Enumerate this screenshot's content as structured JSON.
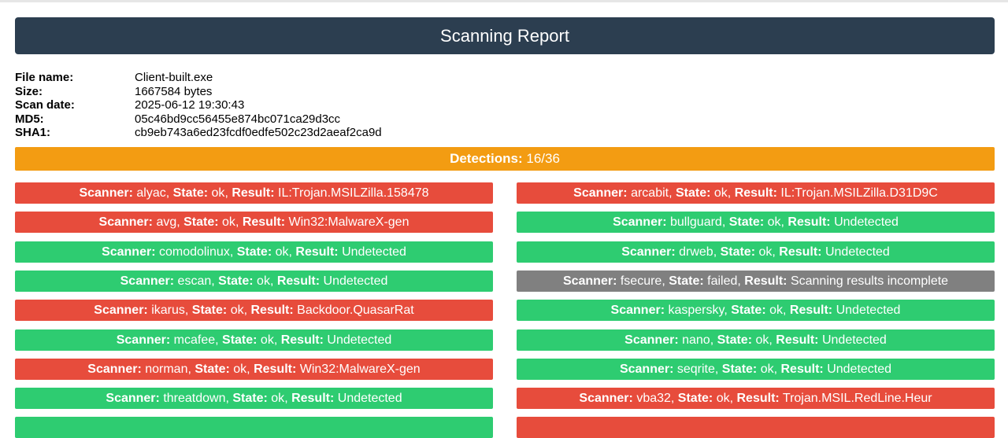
{
  "header": {
    "title": "Scanning Report"
  },
  "file_info": [
    {
      "label": "File name:",
      "value": "Client-built.exe"
    },
    {
      "label": "Size:",
      "value": "1667584 bytes"
    },
    {
      "label": "Scan date:",
      "value": "2025-06-12 19:30:43"
    },
    {
      "label": "MD5:",
      "value": "05c46bd9cc56455e874bc071ca29d3cc"
    },
    {
      "label": "SHA1:",
      "value": "cb9eb743a6ed23fcdf0edfe502c23d2aeaf2ca9d"
    }
  ],
  "detections": {
    "label": "Detections:",
    "value": "16/36"
  },
  "field_labels": {
    "scanner": "Scanner:",
    "state": "State:",
    "result": "Result:"
  },
  "colors": {
    "header_bg": "#2c3e50",
    "detections_bg": "#f39c12",
    "detected": "#e74c3c",
    "undetected": "#2ecc71",
    "failed": "#808080"
  },
  "scanners": [
    {
      "scanner": "alyac",
      "state": "ok",
      "result": "IL:Trojan.MSILZilla.158478",
      "status": "detected"
    },
    {
      "scanner": "arcabit",
      "state": "ok",
      "result": "IL:Trojan.MSILZilla.D31D9C",
      "status": "detected"
    },
    {
      "scanner": "avg",
      "state": "ok",
      "result": "Win32:MalwareX-gen",
      "status": "detected"
    },
    {
      "scanner": "bullguard",
      "state": "ok",
      "result": "Undetected",
      "status": "undetected"
    },
    {
      "scanner": "comodolinux",
      "state": "ok",
      "result": "Undetected",
      "status": "undetected"
    },
    {
      "scanner": "drweb",
      "state": "ok",
      "result": "Undetected",
      "status": "undetected"
    },
    {
      "scanner": "escan",
      "state": "ok",
      "result": "Undetected",
      "status": "undetected"
    },
    {
      "scanner": "fsecure",
      "state": "failed",
      "result": "Scanning results incomplete",
      "status": "failed"
    },
    {
      "scanner": "ikarus",
      "state": "ok",
      "result": "Backdoor.QuasarRat",
      "status": "detected"
    },
    {
      "scanner": "kaspersky",
      "state": "ok",
      "result": "Undetected",
      "status": "undetected"
    },
    {
      "scanner": "mcafee",
      "state": "ok",
      "result": "Undetected",
      "status": "undetected"
    },
    {
      "scanner": "nano",
      "state": "ok",
      "result": "Undetected",
      "status": "undetected"
    },
    {
      "scanner": "norman",
      "state": "ok",
      "result": "Win32:MalwareX-gen",
      "status": "detected"
    },
    {
      "scanner": "seqrite",
      "state": "ok",
      "result": "Undetected",
      "status": "undetected"
    },
    {
      "scanner": "threatdown",
      "state": "ok",
      "result": "Undetected",
      "status": "undetected"
    },
    {
      "scanner": "vba32",
      "state": "ok",
      "result": "Trojan.MSIL.RedLine.Heur",
      "status": "detected"
    }
  ]
}
